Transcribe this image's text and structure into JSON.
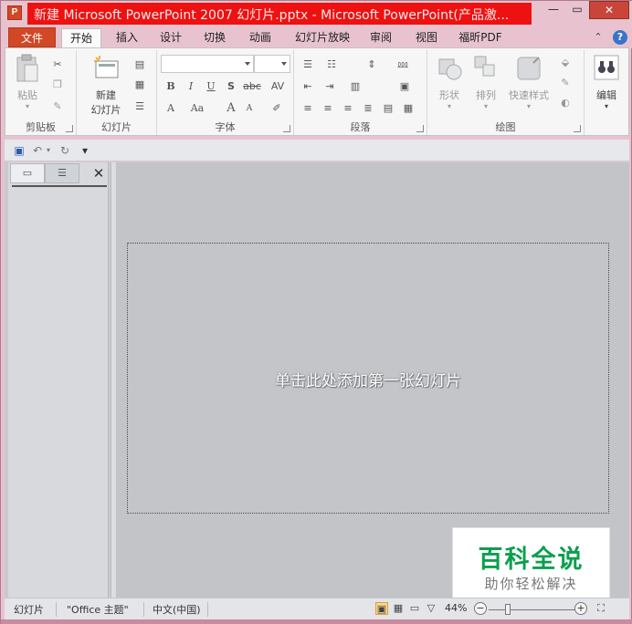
{
  "window": {
    "app_icon_letter": "P",
    "title": "新建 Microsoft PowerPoint 2007 幻灯片.pptx - Microsoft PowerPoint(产品激...",
    "minimize": "—",
    "maximize": "▭",
    "close": "✕"
  },
  "tabs": {
    "file": "文件",
    "items": [
      "开始",
      "插入",
      "设计",
      "切换",
      "动画",
      "幻灯片放映",
      "审阅",
      "视图",
      "福昕PDF"
    ]
  },
  "ribbon": {
    "clipboard": {
      "paste": "粘贴",
      "label": "剪贴板"
    },
    "slides": {
      "new_slide_line1": "新建",
      "new_slide_line2": "幻灯片",
      "label": "幻灯片"
    },
    "font": {
      "label": "字体",
      "bold": "B",
      "italic": "I",
      "underline": "U",
      "shadow": "S",
      "strike": "abc",
      "spacing": "AV",
      "font_color": "A",
      "change_case": "Aa",
      "grow": "A",
      "shrink": "A"
    },
    "paragraph": {
      "label": "段落"
    },
    "drawing": {
      "shapes": "形状",
      "arrange": "排列",
      "quick_styles": "快速样式",
      "label": "绘图"
    },
    "editing": {
      "label": "编辑"
    }
  },
  "main": {
    "slide_placeholder": "单击此处添加第一张幻灯片"
  },
  "watermark": {
    "title": "百科全说",
    "subtitle": "助你轻松解决"
  },
  "statusbar": {
    "slides": "幻灯片",
    "theme": "\"Office 主题\"",
    "language": "中文(中国)",
    "zoom": "44%",
    "zoom_out": "−",
    "zoom_in": "+"
  },
  "colors": {
    "title_highlight": "#ee1111",
    "file_tab": "#d24726",
    "watermark_green": "#0b9f4d"
  }
}
